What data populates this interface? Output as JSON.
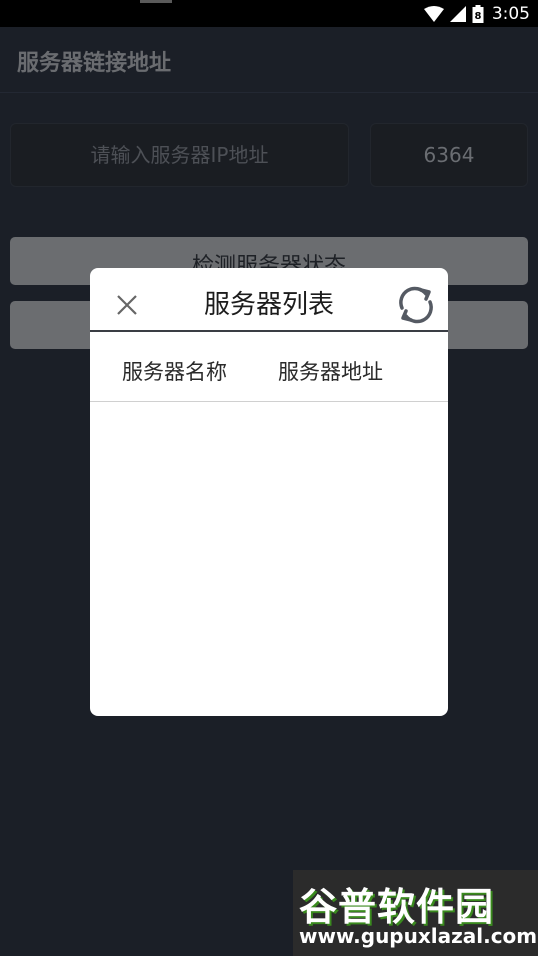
{
  "status_bar": {
    "time": "3:05",
    "battery_level": "8"
  },
  "app_bar": {
    "title": "服务器链接地址"
  },
  "form": {
    "ip_placeholder": "请输入服务器IP地址",
    "port_value": "6364",
    "check_button_label": "检测服务器状态"
  },
  "dialog": {
    "title": "服务器列表",
    "columns": [
      "服务器名称",
      "服务器地址"
    ],
    "rows": []
  },
  "watermark": {
    "brand": "谷普软件园",
    "url": "www.gupuxlazal.com"
  },
  "colors": {
    "background": "#1b1f27",
    "dialog": "#ffffff",
    "button": "#6b6d70",
    "watermark_green": "#4cae2a"
  }
}
